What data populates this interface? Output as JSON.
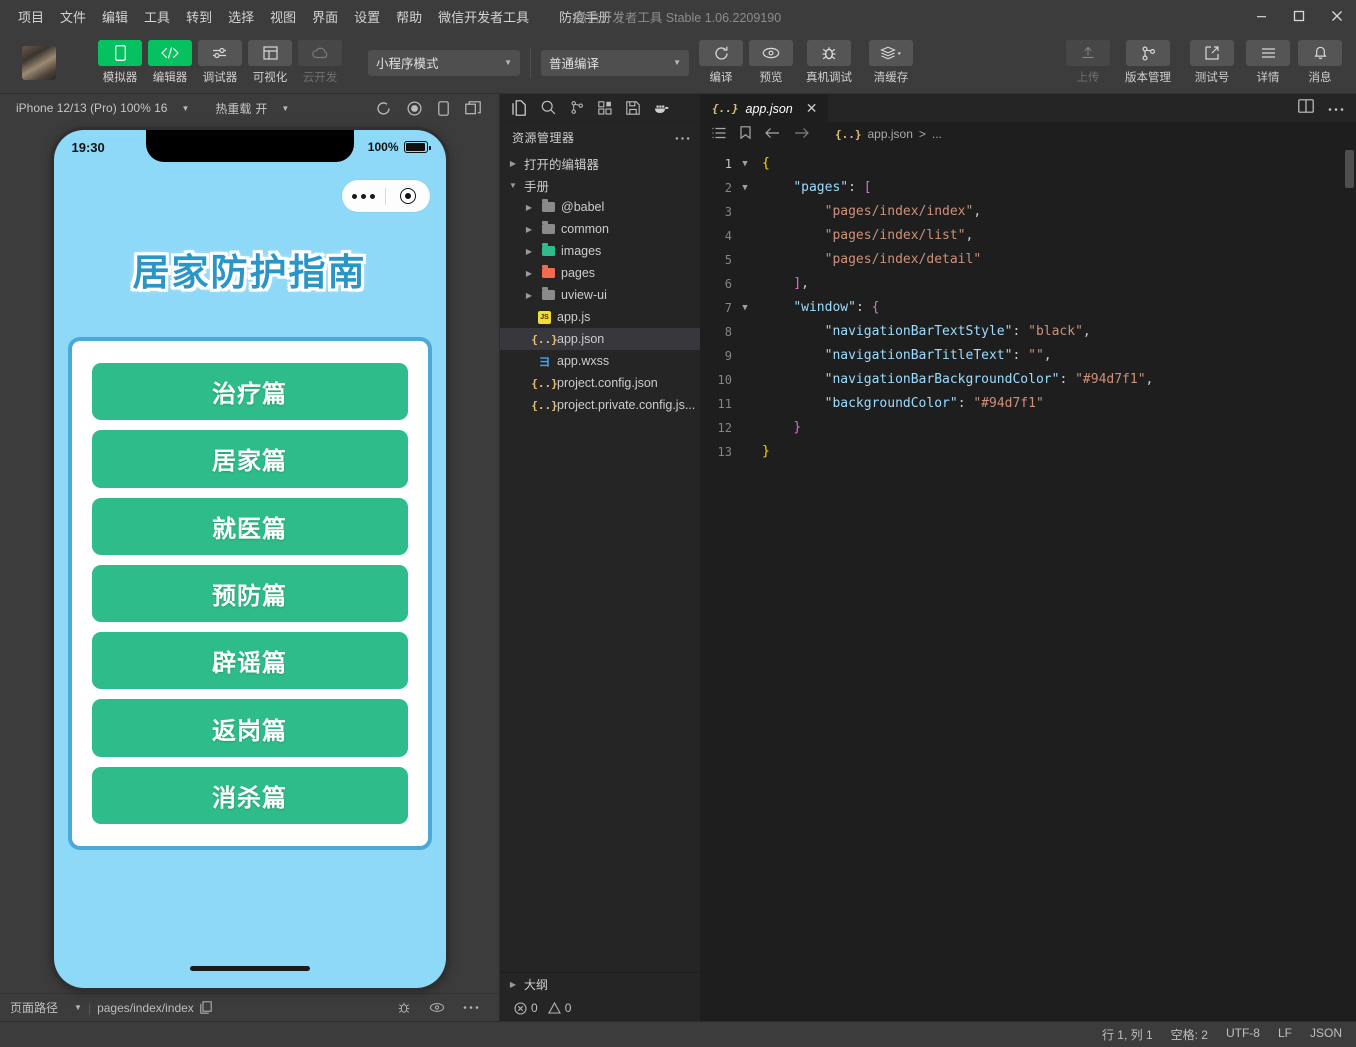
{
  "titlebar": {
    "menus": [
      "项目",
      "文件",
      "编辑",
      "工具",
      "转到",
      "选择",
      "视图",
      "界面",
      "设置",
      "帮助",
      "微信开发者工具"
    ],
    "project_name": "防疫手册",
    "app_version_text": "微信开发者工具 Stable 1.06.2209190",
    "minimize_icon": "minimize-icon",
    "maximize_icon": "maximize-icon",
    "close_icon": "close-icon"
  },
  "toolbar": {
    "avatar_name": "user-avatar",
    "left_tools": [
      {
        "label": "模拟器",
        "icon": "simulator-icon",
        "active": true
      },
      {
        "label": "编辑器",
        "icon": "editor-code-icon",
        "active": true
      },
      {
        "label": "调试器",
        "icon": "debugger-icon",
        "active": false
      },
      {
        "label": "可视化",
        "icon": "visualizer-icon",
        "active": false
      },
      {
        "label": "云开发",
        "icon": "cloud-icon",
        "active": false,
        "disabled": true
      }
    ],
    "mode_select": "小程序模式",
    "compile_select": "普通编译",
    "actions": [
      {
        "label": "编译",
        "icon": "refresh-icon"
      },
      {
        "label": "预览",
        "icon": "eye-icon"
      },
      {
        "label": "真机调试",
        "icon": "bug-icon"
      },
      {
        "label": "清缓存",
        "icon": "layers-icon"
      }
    ],
    "right_tools": [
      {
        "label": "上传",
        "icon": "upload-icon",
        "disabled": true
      },
      {
        "label": "版本管理",
        "icon": "git-branch-icon",
        "disabled": false
      },
      {
        "label": "测试号",
        "icon": "external-link-icon",
        "disabled": false
      },
      {
        "label": "详情",
        "icon": "hamburger-icon",
        "disabled": false
      },
      {
        "label": "消息",
        "icon": "bell-icon",
        "disabled": false
      }
    ]
  },
  "simulator": {
    "device_select": "iPhone 12/13 (Pro) 100% 16",
    "hot_reload_label": "热重载",
    "hot_reload_value": "开",
    "bar_icons": [
      "refresh-icon",
      "record-icon",
      "device-rotate-icon",
      "multi-window-icon"
    ],
    "phone": {
      "time": "19:30",
      "battery_percent": "100%",
      "app_title": "居家防护指南",
      "buttons": [
        "治疗篇",
        "居家篇",
        "就医篇",
        "预防篇",
        "辟谣篇",
        "返岗篇",
        "消杀篇"
      ],
      "bg_color": "#8ed8f8",
      "button_color": "#2ebd8a",
      "card_border_color": "#4aa9d8",
      "title_color": "#2a96c8"
    },
    "footer": {
      "page_path_label": "页面路径",
      "page_path_value": "pages/index/index",
      "copy_icon": "copy-icon",
      "icons": [
        "bug-icon",
        "eye-icon",
        "more-icon"
      ]
    }
  },
  "explorer": {
    "activity_icons": [
      "files-icon",
      "search-icon",
      "source-control-icon",
      "extensions-icon",
      "save-all-icon",
      "docker-icon"
    ],
    "header_title": "资源管理器",
    "header_more_icon": "more-icon",
    "open_editors_label": "打开的编辑器",
    "root_label": "手册",
    "items": [
      {
        "label": "@babel",
        "type": "folder",
        "icon": "folder-icon",
        "depth": 2
      },
      {
        "label": "common",
        "type": "folder",
        "icon": "folder-icon",
        "depth": 2
      },
      {
        "label": "images",
        "type": "folder",
        "icon": "folder-images-icon",
        "depth": 2
      },
      {
        "label": "pages",
        "type": "folder",
        "icon": "folder-pages-icon",
        "depth": 2
      },
      {
        "label": "uview-ui",
        "type": "folder",
        "icon": "folder-icon",
        "depth": 2
      },
      {
        "label": "app.js",
        "type": "js",
        "icon": "js-file-icon",
        "depth": 3
      },
      {
        "label": "app.json",
        "type": "json",
        "icon": "json-file-icon",
        "depth": 3,
        "selected": true
      },
      {
        "label": "app.wxss",
        "type": "wxss",
        "icon": "wxss-file-icon",
        "depth": 3
      },
      {
        "label": "project.config.json",
        "type": "json",
        "icon": "json-file-icon",
        "depth": 3
      },
      {
        "label": "project.private.config.js...",
        "type": "json",
        "icon": "json-file-icon",
        "depth": 3
      }
    ],
    "outline_label": "大纲",
    "errors_count": "0",
    "warnings_count": "0"
  },
  "editor": {
    "tab": {
      "label": "app.json",
      "icon": "json-file-icon",
      "close_icon": "close-icon"
    },
    "tab_right_icons": [
      "split-editor-icon",
      "more-icon"
    ],
    "breadcrumb_icons": [
      "outline-list-icon",
      "bookmark-icon",
      "back-arrow-icon",
      "forward-arrow-icon"
    ],
    "breadcrumb_file": "app.json",
    "breadcrumb_tail": "...",
    "lines": [
      {
        "n": "1",
        "fold": "v",
        "segs": [
          {
            "t": "{",
            "c": "brace"
          }
        ]
      },
      {
        "n": "2",
        "fold": "v",
        "segs": [
          {
            "t": "    ",
            "c": "p"
          },
          {
            "t": "\"pages\"",
            "c": "key"
          },
          {
            "t": ": ",
            "c": "p"
          },
          {
            "t": "[",
            "c": "brace2"
          }
        ]
      },
      {
        "n": "3",
        "fold": "",
        "segs": [
          {
            "t": "        ",
            "c": "p"
          },
          {
            "t": "\"pages/index/index\"",
            "c": "str"
          },
          {
            "t": ",",
            "c": "p"
          }
        ]
      },
      {
        "n": "4",
        "fold": "",
        "segs": [
          {
            "t": "        ",
            "c": "p"
          },
          {
            "t": "\"pages/index/list\"",
            "c": "str"
          },
          {
            "t": ",",
            "c": "p"
          }
        ]
      },
      {
        "n": "5",
        "fold": "",
        "segs": [
          {
            "t": "        ",
            "c": "p"
          },
          {
            "t": "\"pages/index/detail\"",
            "c": "str"
          }
        ]
      },
      {
        "n": "6",
        "fold": "",
        "segs": [
          {
            "t": "    ",
            "c": "p"
          },
          {
            "t": "]",
            "c": "brace2"
          },
          {
            "t": ",",
            "c": "p"
          }
        ]
      },
      {
        "n": "7",
        "fold": "v",
        "segs": [
          {
            "t": "    ",
            "c": "p"
          },
          {
            "t": "\"window\"",
            "c": "key"
          },
          {
            "t": ": ",
            "c": "p"
          },
          {
            "t": "{",
            "c": "brace2"
          }
        ]
      },
      {
        "n": "8",
        "fold": "",
        "segs": [
          {
            "t": "        ",
            "c": "p"
          },
          {
            "t": "\"navigationBarTextStyle\"",
            "c": "key"
          },
          {
            "t": ": ",
            "c": "p"
          },
          {
            "t": "\"black\"",
            "c": "str"
          },
          {
            "t": ",",
            "c": "p"
          }
        ]
      },
      {
        "n": "9",
        "fold": "",
        "segs": [
          {
            "t": "        ",
            "c": "p"
          },
          {
            "t": "\"navigationBarTitleText\"",
            "c": "key"
          },
          {
            "t": ": ",
            "c": "p"
          },
          {
            "t": "\"\"",
            "c": "str"
          },
          {
            "t": ",",
            "c": "p"
          }
        ]
      },
      {
        "n": "10",
        "fold": "",
        "segs": [
          {
            "t": "        ",
            "c": "p"
          },
          {
            "t": "\"navigationBarBackgroundColor\"",
            "c": "key"
          },
          {
            "t": ": ",
            "c": "p"
          },
          {
            "t": "\"#94d7f1\"",
            "c": "str"
          },
          {
            "t": ",",
            "c": "p"
          }
        ]
      },
      {
        "n": "11",
        "fold": "",
        "segs": [
          {
            "t": "        ",
            "c": "p"
          },
          {
            "t": "\"backgroundColor\"",
            "c": "key"
          },
          {
            "t": ": ",
            "c": "p"
          },
          {
            "t": "\"#94d7f1\"",
            "c": "str"
          }
        ]
      },
      {
        "n": "12",
        "fold": "",
        "segs": [
          {
            "t": "    ",
            "c": "p"
          },
          {
            "t": "}",
            "c": "brace2"
          }
        ]
      },
      {
        "n": "13",
        "fold": "",
        "segs": [
          {
            "t": "}",
            "c": "brace"
          }
        ]
      }
    ]
  },
  "statusbar": {
    "cursor": "行 1, 列 1",
    "spaces": "空格: 2",
    "encoding": "UTF-8",
    "eol": "LF",
    "language": "JSON"
  }
}
